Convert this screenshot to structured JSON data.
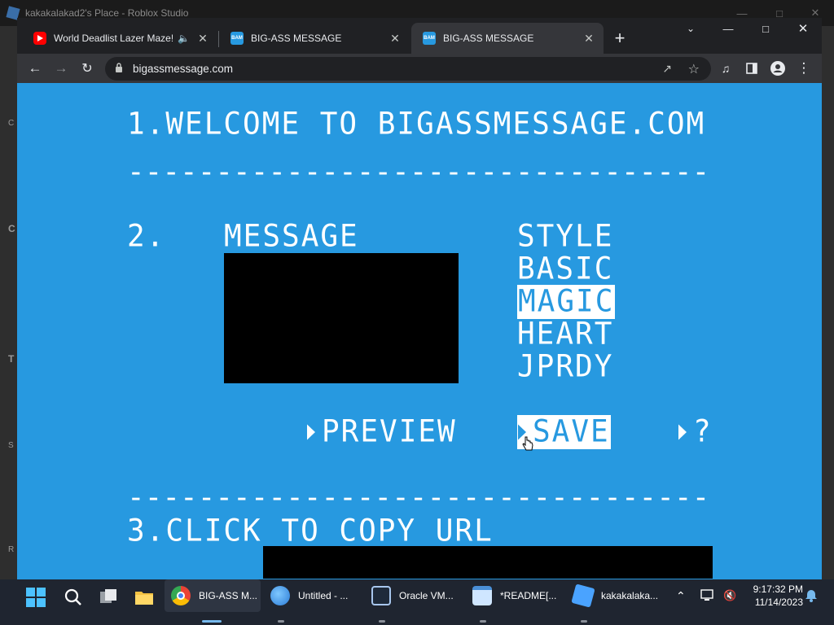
{
  "studio": {
    "title": "kakakalakad2's Place - Roblox Studio",
    "side_letters": [
      "C",
      "C",
      "T",
      "S",
      "R"
    ]
  },
  "browser": {
    "tabs": [
      {
        "title": "World Deadlist Lazer Maze! |",
        "favicon": "youtube-icon",
        "audio": true,
        "active": false
      },
      {
        "title": "BIG-ASS MESSAGE",
        "favicon": "bam-icon",
        "active": false
      },
      {
        "title": "BIG-ASS MESSAGE",
        "favicon": "bam-icon",
        "active": true
      }
    ],
    "favicon_text": "BAM",
    "url": "bigassmessage.com"
  },
  "page": {
    "heading1": "1.WELCOME TO BIGASSMESSAGE.COM",
    "step2": "2.",
    "message_label": "MESSAGE",
    "style_label": "STYLE",
    "style_options": [
      "BASIC",
      "MAGIC",
      "HEART",
      "JPRDY"
    ],
    "selected_style": "MAGIC",
    "preview_label": "PREVIEW",
    "save_label": "SAVE",
    "help_label": "?",
    "heading3": "3.CLICK TO COPY URL",
    "dash_line": "------------------------------------"
  },
  "taskbar": {
    "items": [
      {
        "label": "BIG-ASS M...",
        "icon": "chrome-icon",
        "active": true
      },
      {
        "label": "Untitled - ...",
        "icon": "paint-icon",
        "active": false
      },
      {
        "label": "Oracle VM...",
        "icon": "virtualbox-icon",
        "active": false
      },
      {
        "label": "*README[...",
        "icon": "notepad-icon",
        "active": false
      },
      {
        "label": "kakakalaka...",
        "icon": "roblox-studio-icon",
        "active": false
      }
    ],
    "time": "9:17:32 PM",
    "date": "11/14/2023"
  },
  "colors": {
    "page_bg": "#2799e0",
    "chrome_bg": "#202124",
    "toolbar_bg": "#35363a",
    "taskbar_bg": "#1f2530"
  }
}
